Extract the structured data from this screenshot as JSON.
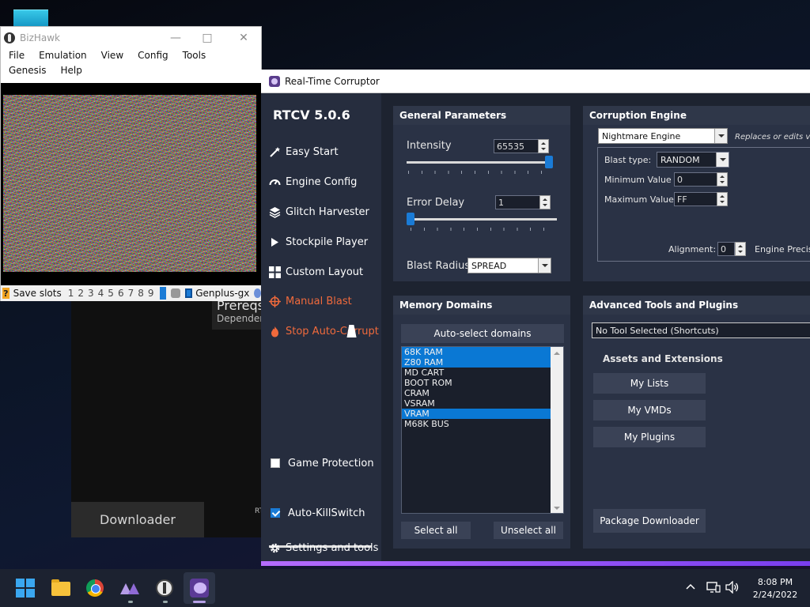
{
  "desktop": {
    "prereq_title": "Prereqs",
    "prereq_sub": "Dependen",
    "downloader_label": "Downloader",
    "rt_label": "RT"
  },
  "bizhawk": {
    "title": "BizHawk",
    "menu": [
      "File",
      "Emulation",
      "View",
      "Config",
      "Tools",
      "Genesis",
      "Help"
    ],
    "status": {
      "save_slots_label": "Save slots",
      "slots": [
        "1",
        "2",
        "3",
        "4",
        "5",
        "6",
        "7",
        "8",
        "9"
      ],
      "core_label": "Genplus-gx"
    }
  },
  "rtc": {
    "window_title": "Real-Time Corruptor",
    "version": "RTCV 5.0.6",
    "sidebar": {
      "easy_start": "Easy Start",
      "engine_config": "Engine Config",
      "glitch_harvester": "Glitch Harvester",
      "stockpile_player": "Stockpile Player",
      "custom_layout": "Custom Layout",
      "manual_blast": "Manual Blast",
      "stop_auto_corrupt": "Stop Auto-Corrupt",
      "game_protection": "Game Protection",
      "auto_killswitch": "Auto-KillSwitch",
      "settings_and_tools": "Settings and tools"
    },
    "general": {
      "title": "General Parameters",
      "intensity_label": "Intensity",
      "intensity_value": "65535",
      "intensity_level": 1.0,
      "error_delay_label": "Error Delay",
      "error_delay_value": "1",
      "error_delay_level": 0.0,
      "blast_radius_label": "Blast Radius:",
      "blast_radius_value": "SPREAD"
    },
    "engine": {
      "title": "Corruption Engine",
      "selected_engine": "Nightmare Engine",
      "description": "Replaces or edits val",
      "blast_type_label": "Blast type:",
      "blast_type_value": "RANDOM",
      "min_value_label": "Minimum Value",
      "min_value": "0",
      "max_value_label": "Maximum Value",
      "max_value": "FF",
      "alignment_label": "Alignment:",
      "alignment_value": "0",
      "engine_precision_label": "Engine Precisi"
    },
    "memory": {
      "title": "Memory Domains",
      "auto_select_label": "Auto-select domains",
      "domains": [
        {
          "name": "68K RAM",
          "selected": true
        },
        {
          "name": "Z80 RAM",
          "selected": true
        },
        {
          "name": "MD CART",
          "selected": false
        },
        {
          "name": "BOOT ROM",
          "selected": false
        },
        {
          "name": "CRAM",
          "selected": false
        },
        {
          "name": "VSRAM",
          "selected": false
        },
        {
          "name": "VRAM",
          "selected": true
        },
        {
          "name": "M68K BUS",
          "selected": false
        }
      ],
      "select_all_label": "Select all",
      "unselect_all_label": "Unselect all"
    },
    "tools": {
      "title": "Advanced Tools and Plugins",
      "selected_tool": "No Tool Selected (Shortcuts)",
      "assets_label": "Assets and Extensions",
      "my_lists": "My Lists",
      "my_vmds": "My VMDs",
      "my_plugins": "My Plugins",
      "package_downloader": "Package Downloader"
    }
  },
  "taskbar": {
    "time": "8:08 PM",
    "date": "2/24/2022"
  }
}
